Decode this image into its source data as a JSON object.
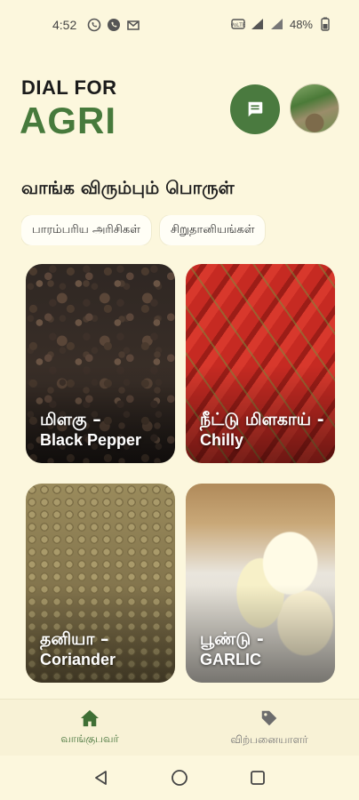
{
  "status_bar": {
    "time": "4:52",
    "battery": "48%",
    "icons": [
      "whatsapp-icon",
      "phone-icon",
      "gmail-icon",
      "volte-icon",
      "wifi-signal-icon",
      "cell-signal-icon",
      "battery-icon"
    ]
  },
  "header": {
    "brand_top": "DIAL FOR",
    "brand_main": "AGRI",
    "brand_color": "#477a3c"
  },
  "section_title": "வாங்க விரும்பும் பொருள்",
  "chips": [
    "பாரம்பரிய அரிசிகள்",
    "சிறுதானியங்கள்"
  ],
  "products": [
    {
      "tamil": "மிளகு –",
      "english": "Black Pepper"
    },
    {
      "tamil": "நீட்டு மிளகாய் -",
      "english": "Chilly"
    },
    {
      "tamil": "தனியா –",
      "english": "Coriander"
    },
    {
      "tamil": "பூண்டு -",
      "english": "GARLIC"
    }
  ],
  "bottom_nav": {
    "buyer": "வாங்குபவர்",
    "seller": "விற்பனையாளர்"
  }
}
